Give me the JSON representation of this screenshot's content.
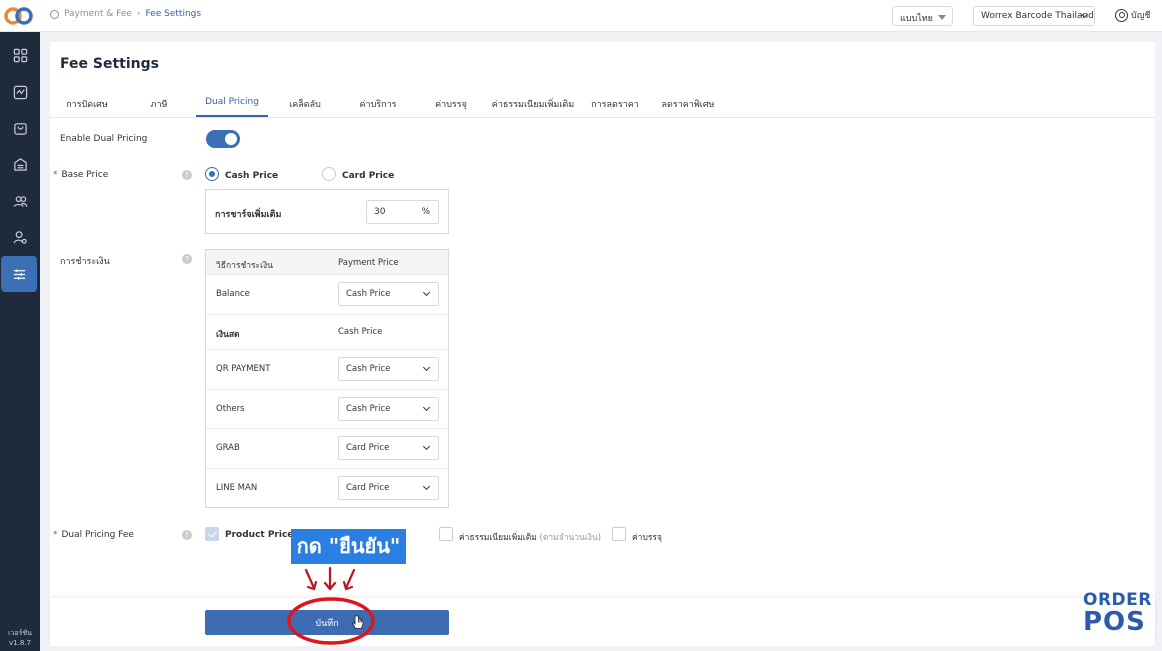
{
  "breadcrumb": {
    "parent": "Payment & Fee",
    "current": "Fee Settings"
  },
  "header": {
    "language": "แบบไทย",
    "store": "Worrex Barcode Thailand",
    "account": "บัญชี"
  },
  "sidebar": {
    "items": [
      "dashboard-icon",
      "report-icon",
      "bag-icon",
      "inventory-icon",
      "customers-icon",
      "user-settings-icon",
      "settings-sliders-icon"
    ],
    "active_index": 6,
    "version_label": "เวอร์ชัน",
    "version": "v1.8.7"
  },
  "page": {
    "title": "Fee Settings"
  },
  "tabs": [
    "การปัดเศษ",
    "ภาษี",
    "Dual Pricing",
    "เคล็ดลับ",
    "ค่าบริการ",
    "ค่าบรรจุ",
    "ค่าธรรมเนียมเพิ่มเติม",
    "การลดราคา",
    "ลดราคาพิเศษ"
  ],
  "active_tab": "Dual Pricing",
  "form": {
    "enable_label": "Enable Dual Pricing",
    "enable_value": true,
    "base_price_label": "Base Price",
    "base_price_options": [
      "Cash Price",
      "Card Price"
    ],
    "base_price_selected": "Cash Price",
    "surcharge_label": "การชาร์จเพิ่มเติม",
    "surcharge_value": "30",
    "surcharge_unit": "%",
    "payment_label": "การชำระเงิน",
    "payment_table": {
      "headers": [
        "วิธีการชำระเงิน",
        "Payment Price"
      ],
      "rows": [
        {
          "method": "Balance",
          "price": "Cash Price",
          "editable": true
        },
        {
          "method": "เงินสด",
          "price": "Cash Price",
          "editable": false
        },
        {
          "method": "QR PAYMENT",
          "price": "Cash Price",
          "editable": true
        },
        {
          "method": "Others",
          "price": "Cash Price",
          "editable": true
        },
        {
          "method": "GRAB",
          "price": "Card Price",
          "editable": true
        },
        {
          "method": "LINE MAN",
          "price": "Card Price",
          "editable": true
        }
      ]
    },
    "fee_label": "Dual Pricing Fee",
    "fee_options": [
      {
        "label": "Product Price",
        "checked": true
      },
      {
        "label": "ค่าธรรมเนียมเพิ่มเติม",
        "note": "(ตามจำนวนเงิน)",
        "checked": false
      },
      {
        "label": "ค่าบรรจุ",
        "checked": false
      }
    ]
  },
  "footer": {
    "save_label": "บันทึก"
  },
  "annotation": {
    "callout": "กด \"ยืนยัน\""
  },
  "brand": {
    "line1": "ORDER",
    "line2": "POS"
  },
  "colors": {
    "primary": "#3b6fb6",
    "sidebar": "#1f2b3c",
    "accent": "#2a7fe0",
    "annotation_ring": "#e0141b"
  }
}
